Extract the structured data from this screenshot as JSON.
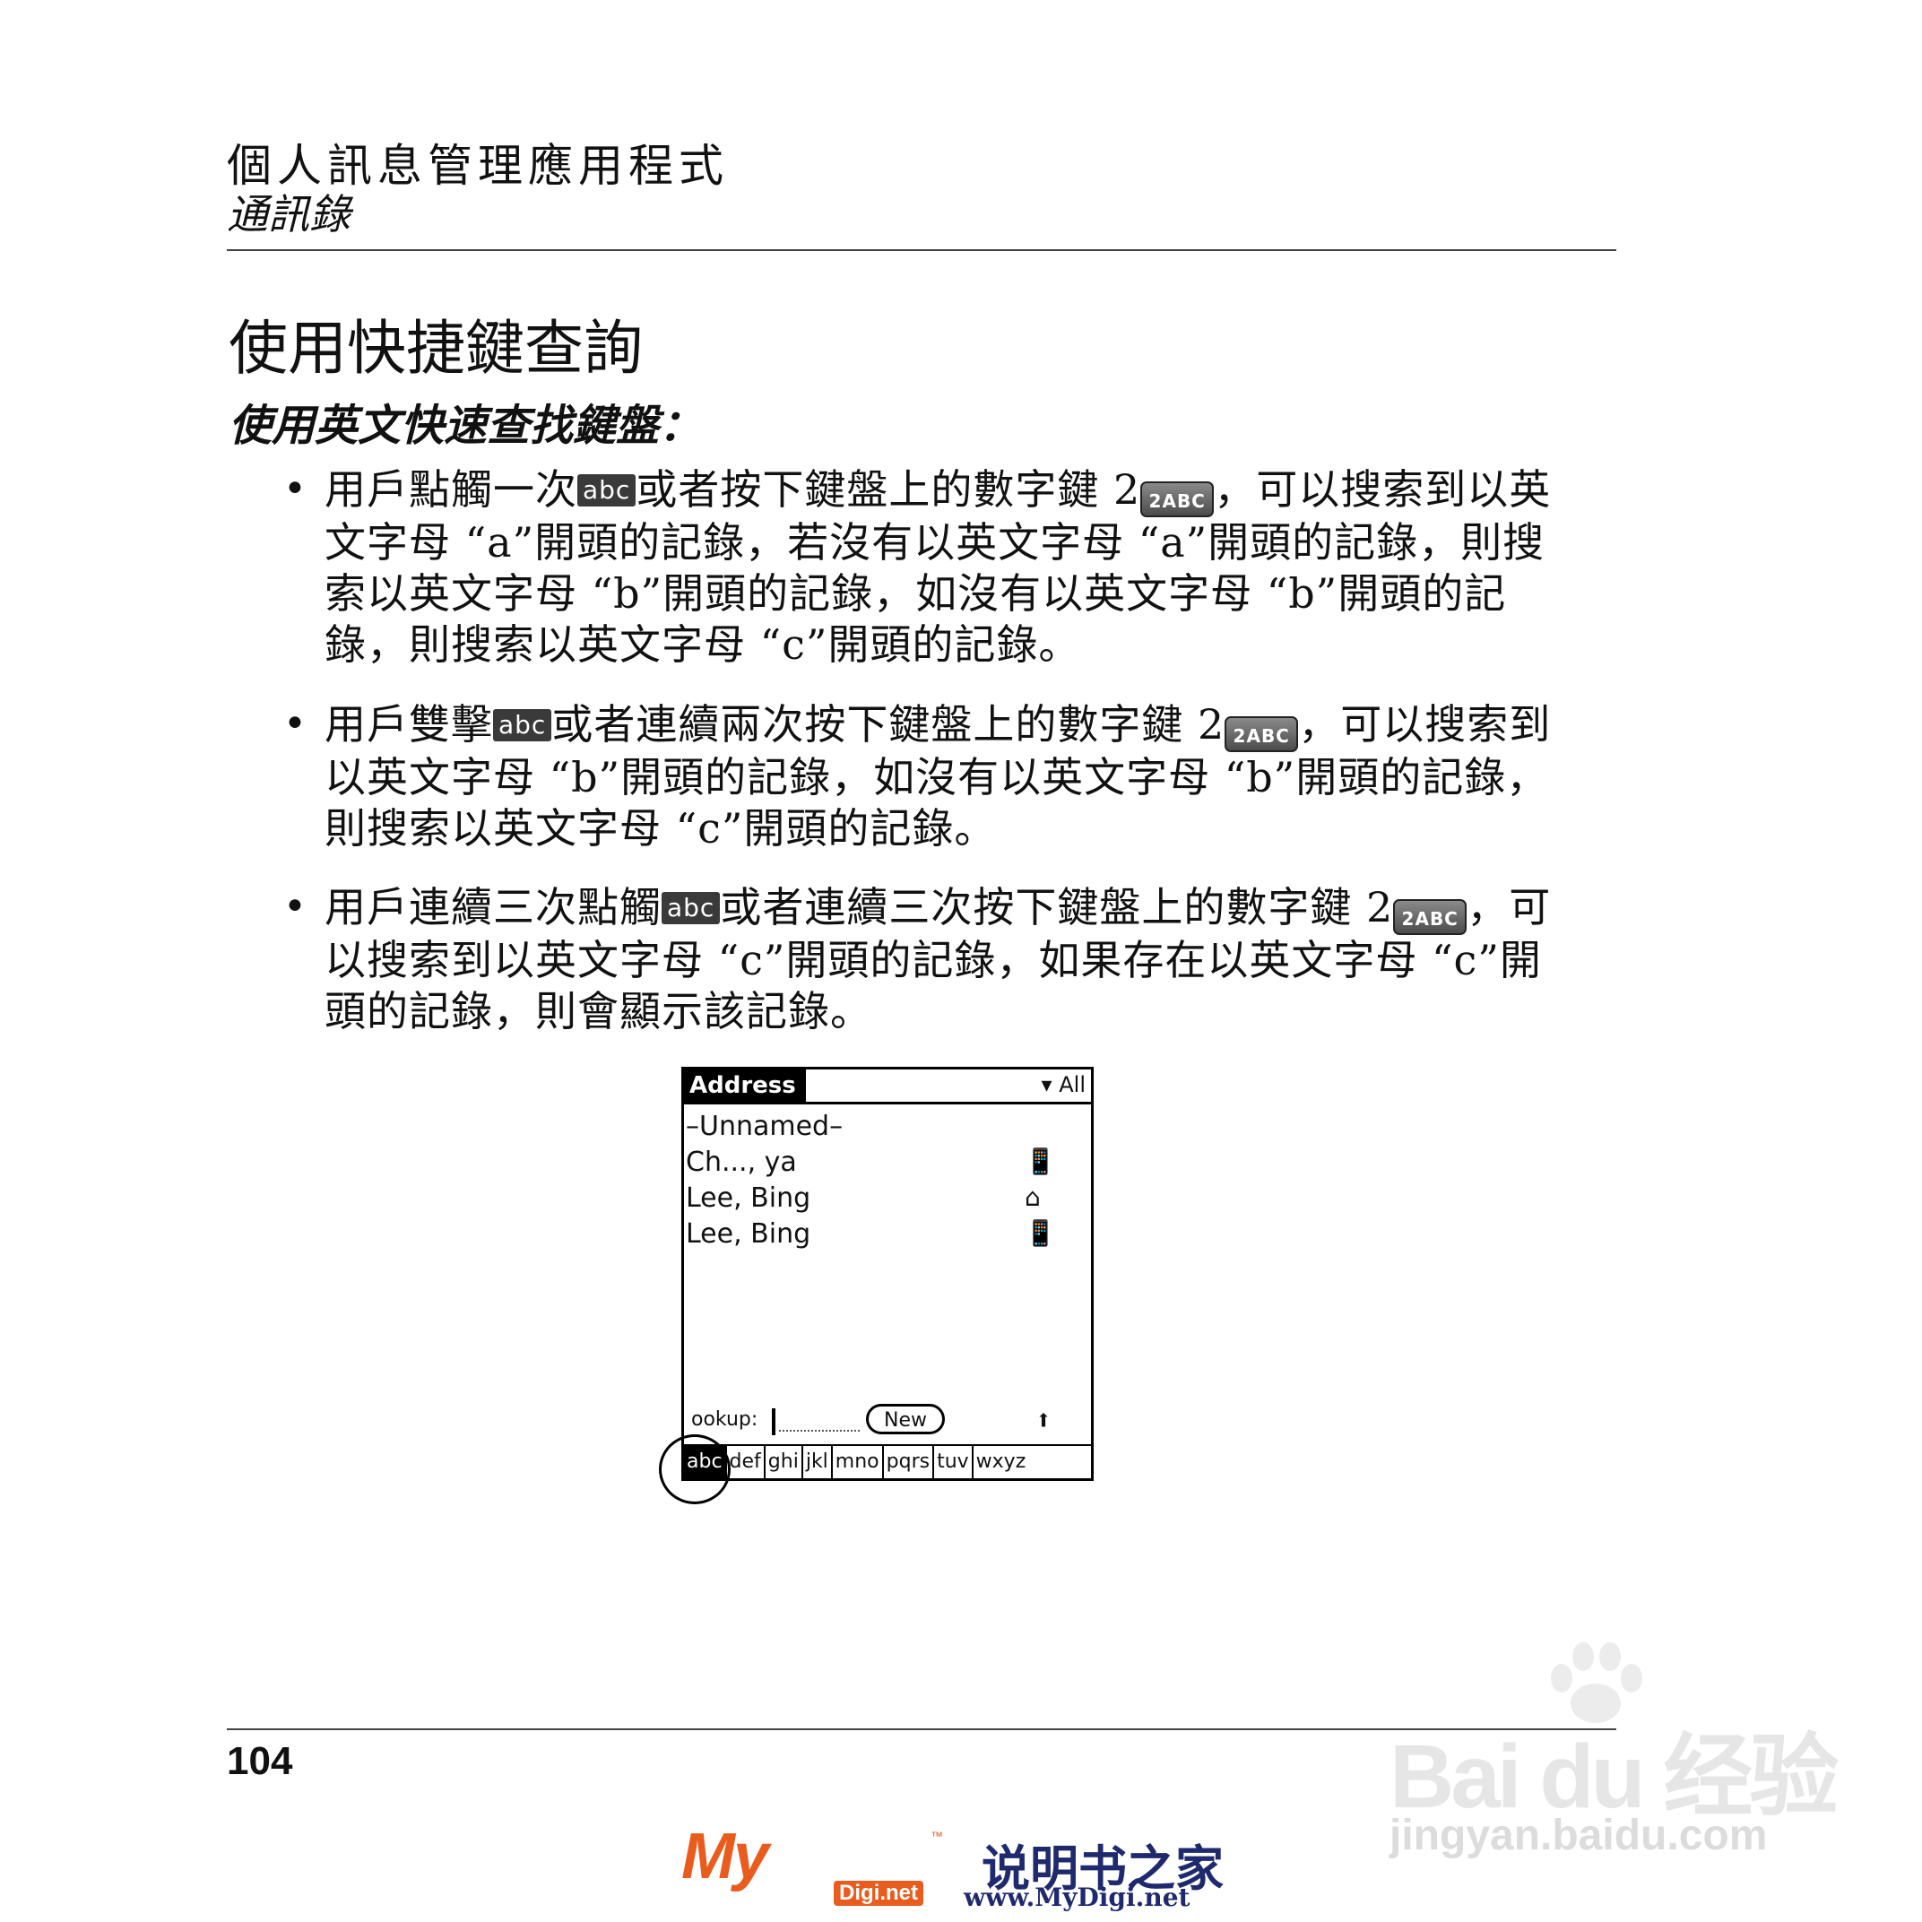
{
  "header": {
    "section": "個人訊息管理應用程式",
    "subsection": "通訊錄"
  },
  "content": {
    "title": "使用快捷鍵查詢",
    "subtitle": "使用英文快速查找鍵盤：",
    "chip_label": "abc",
    "key_label": "2ABC",
    "bullets": [
      {
        "a": "用戶點觸一次",
        "b": "或者按下鍵盤上的數字鍵 2",
        "c": "，可以搜索到以英文字母 “a”開頭的記錄，若沒有以英文字母 “a”開頭的記錄，則搜索以英文字母 “b”開頭的記錄，如沒有以英文字母 “b”開頭的記錄，則搜索以英文字母 “c”開頭的記錄。"
      },
      {
        "a": "用戶雙擊",
        "b": "或者連續兩次按下鍵盤上的數字鍵 2",
        "c": "，可以搜索到以英文字母 “b”開頭的記錄，如沒有以英文字母 “b”開頭的記錄，則搜索以英文字母 “c”開頭的記錄。"
      },
      {
        "a": "用戶連續三次點觸",
        "b": "或者連續三次按下鍵盤上的數字鍵 2",
        "c": "，可以搜索到以英文字母 “c”開頭的記錄，如果存在以英文字母 “c”開頭的記錄，則會顯示該記錄。"
      }
    ]
  },
  "palm": {
    "title": "Address",
    "category": "All",
    "rows": [
      {
        "name": "–Unnamed–",
        "icon": ""
      },
      {
        "name": "Ch..., ya",
        "icon": "mobile-phone-icon"
      },
      {
        "name": "Lee, Bing",
        "icon": "home-icon"
      },
      {
        "name": "Lee, Bing",
        "icon": "mobile-phone-icon"
      }
    ],
    "lookup_label": "ookup:",
    "new_label": "New",
    "tabs": [
      "abc",
      "def",
      "ghi",
      "jkl",
      "mno",
      "pqrs",
      "tuv",
      "wxyz"
    ]
  },
  "footer": {
    "page_number": "104",
    "logo_text": "My",
    "logo_tm": "™",
    "logo_digi": "Digi.net",
    "logo_cn": "说明书之家",
    "logo_url": "www.MyDigi.net"
  },
  "watermark": {
    "brand": "Bai du 经验",
    "url": "jingyan.baidu.com"
  }
}
